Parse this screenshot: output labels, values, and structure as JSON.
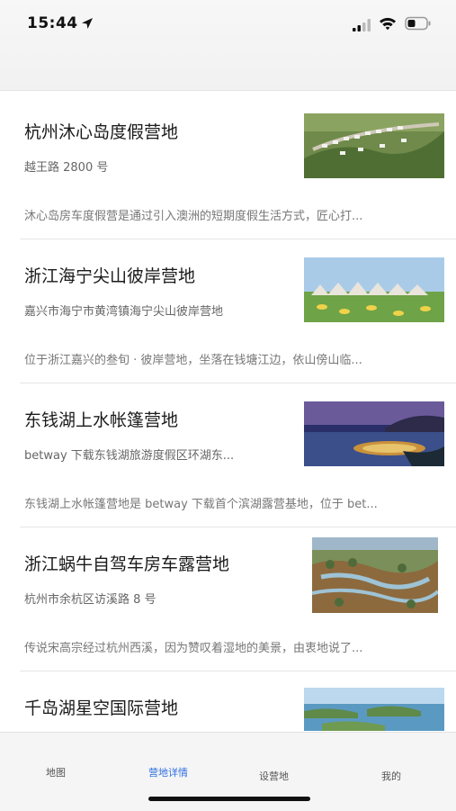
{
  "status_bar": {
    "time": "15:44",
    "icons": [
      "location-arrow-icon",
      "signal-icon",
      "wifi-icon",
      "battery-icon"
    ]
  },
  "campsites": [
    {
      "title": "杭州沐心岛度假营地",
      "address": "越王路 2800 号",
      "description": "沐心岛房车度假营是通过引入澳洲的短期度假生活方式，匠心打...",
      "image_desc": "aerial-campsite-photo"
    },
    {
      "title": "浙江海宁尖山彼岸营地",
      "address": "嘉兴市海宁市黄湾镇海宁尖山彼岸营地",
      "description": "位于浙江嘉兴的叁旬 · 彼岸营地，坐落在钱塘江边，依山傍山临...",
      "image_desc": "tents-on-lawn-photo"
    },
    {
      "title": "东钱湖上水帐篷营地",
      "address": "betway 下载东钱湖旅游度假区环湖东...",
      "description": "东钱湖上水帐篷营地是 betway 下载首个滨湖露营基地，位于 bet...",
      "image_desc": "lakeside-night-photo"
    },
    {
      "title": "浙江蜗牛自驾车房车露营地",
      "address": "杭州市余杭区访溪路 8 号",
      "description": "传说宋高宗经过杭州西溪，因为赞叹着湿地的美景，由衷地说了...",
      "image_desc": "wetland-aerial-photo"
    },
    {
      "title": "千岛湖星空国际营地",
      "address": "",
      "description": "",
      "image_desc": "islands-lake-photo"
    }
  ],
  "tab_bar": {
    "tabs": [
      {
        "label": "地图",
        "active": false
      },
      {
        "label": "营地详情",
        "active": true
      },
      {
        "label": "设营地",
        "active": false
      },
      {
        "label": "我的",
        "active": false
      }
    ],
    "active_color": "#2f6fe0",
    "inactive_color": "#555555"
  }
}
